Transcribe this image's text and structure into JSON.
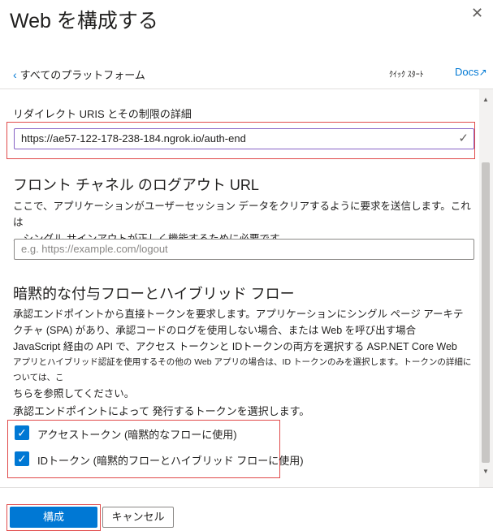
{
  "panel": {
    "title": "Web を構成する"
  },
  "nav": {
    "back_label": "すべてのプラットフォーム",
    "quickstart_label": "ｸｲｯｸ ｽﾀｰﾄ",
    "docs_label": "Docs"
  },
  "redirect": {
    "label": "リダイレクト URIS とその制限の詳細",
    "value": "https://ae57-122-178-238-184.ngrok.io/auth-end"
  },
  "logout": {
    "heading": "フロント チャネル のログアウト URL",
    "description_1": "ここで、アプリケーションがユーザーセッション データをクリアするように要求を送信します。これは",
    "description_2": "、シングル サインアウトが正しく機能するために必要です。",
    "placeholder": "e.g. https://example.com/logout"
  },
  "implicit": {
    "heading": "暗黙的な付与フローとハイブリッド フロー",
    "line1": "承認エンドポイントから直接トークンを要求します。アプリケーションにシングル ページ アーキテ",
    "line2": "クチャ (SPA) があり、承認コードのログを使用しない場合、または Web を呼び出す場合",
    "line3": "JavaScript 経由の API で、アクセス トークンと IDトークンの両方を選択する ASP.NET Core Web",
    "line4": "アプリとハイブリッド認証を使用するその他の Web アプリの場合は、ID トークンのみを選択します。トークンの詳細については、こ",
    "line5": "ちらを参照してください。",
    "select_prompt": "承認エンドポイントによって 発行するトークンを選択します。",
    "access_token_label": "アクセストークン (暗黙的なフローに使用)",
    "id_token_label": "IDトークン (暗黙的フローとハイブリッド フローに使用)",
    "access_token_checked": true,
    "id_token_checked": true
  },
  "footer": {
    "configure_label": "構成",
    "cancel_label": "キャンセル"
  },
  "colors": {
    "accent": "#0078d4",
    "highlight": "#e04a4a"
  }
}
